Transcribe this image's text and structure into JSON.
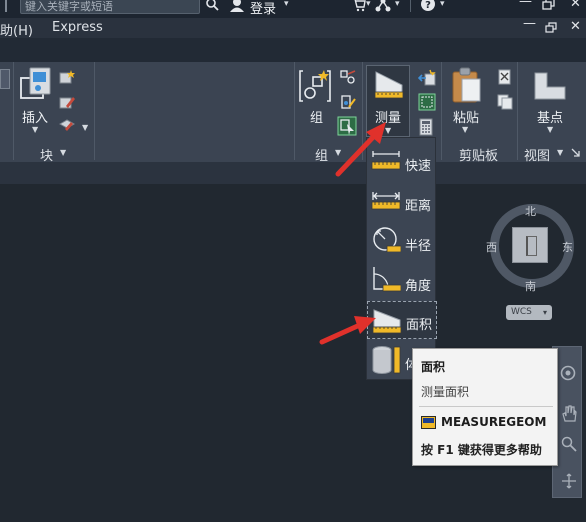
{
  "topbar": {
    "search_placeholder": "键入关键字或短语",
    "login_label": "登录"
  },
  "menubar": {
    "help_menu": "助(H)",
    "express_menu": "Express"
  },
  "ribbon": {
    "insert_label": "插入",
    "block_panel": "块",
    "group_label": "组",
    "group_panel": "组",
    "measure_label": "测量",
    "paste_label": "粘贴",
    "clipboard_panel": "剪贴板",
    "basepoint_label": "基点",
    "view_panel": "视图"
  },
  "measure_menu": {
    "items": [
      {
        "label": "快速"
      },
      {
        "label": "距离"
      },
      {
        "label": "半径"
      },
      {
        "label": "角度"
      },
      {
        "label": "面积"
      },
      {
        "label": "体"
      }
    ]
  },
  "tooltip": {
    "title": "面积",
    "description": "测量面积",
    "command": "MEASUREGEOM",
    "help": "按 F1 键获得更多帮助"
  },
  "viewcube": {
    "north": "北",
    "south": "南",
    "east": "东",
    "west": "西",
    "wcs": "WCS"
  },
  "colors": {
    "accent_arrow": "#e0312b",
    "ruler_yellow": "#f0b928",
    "ribbon_bg": "#3b4452"
  }
}
